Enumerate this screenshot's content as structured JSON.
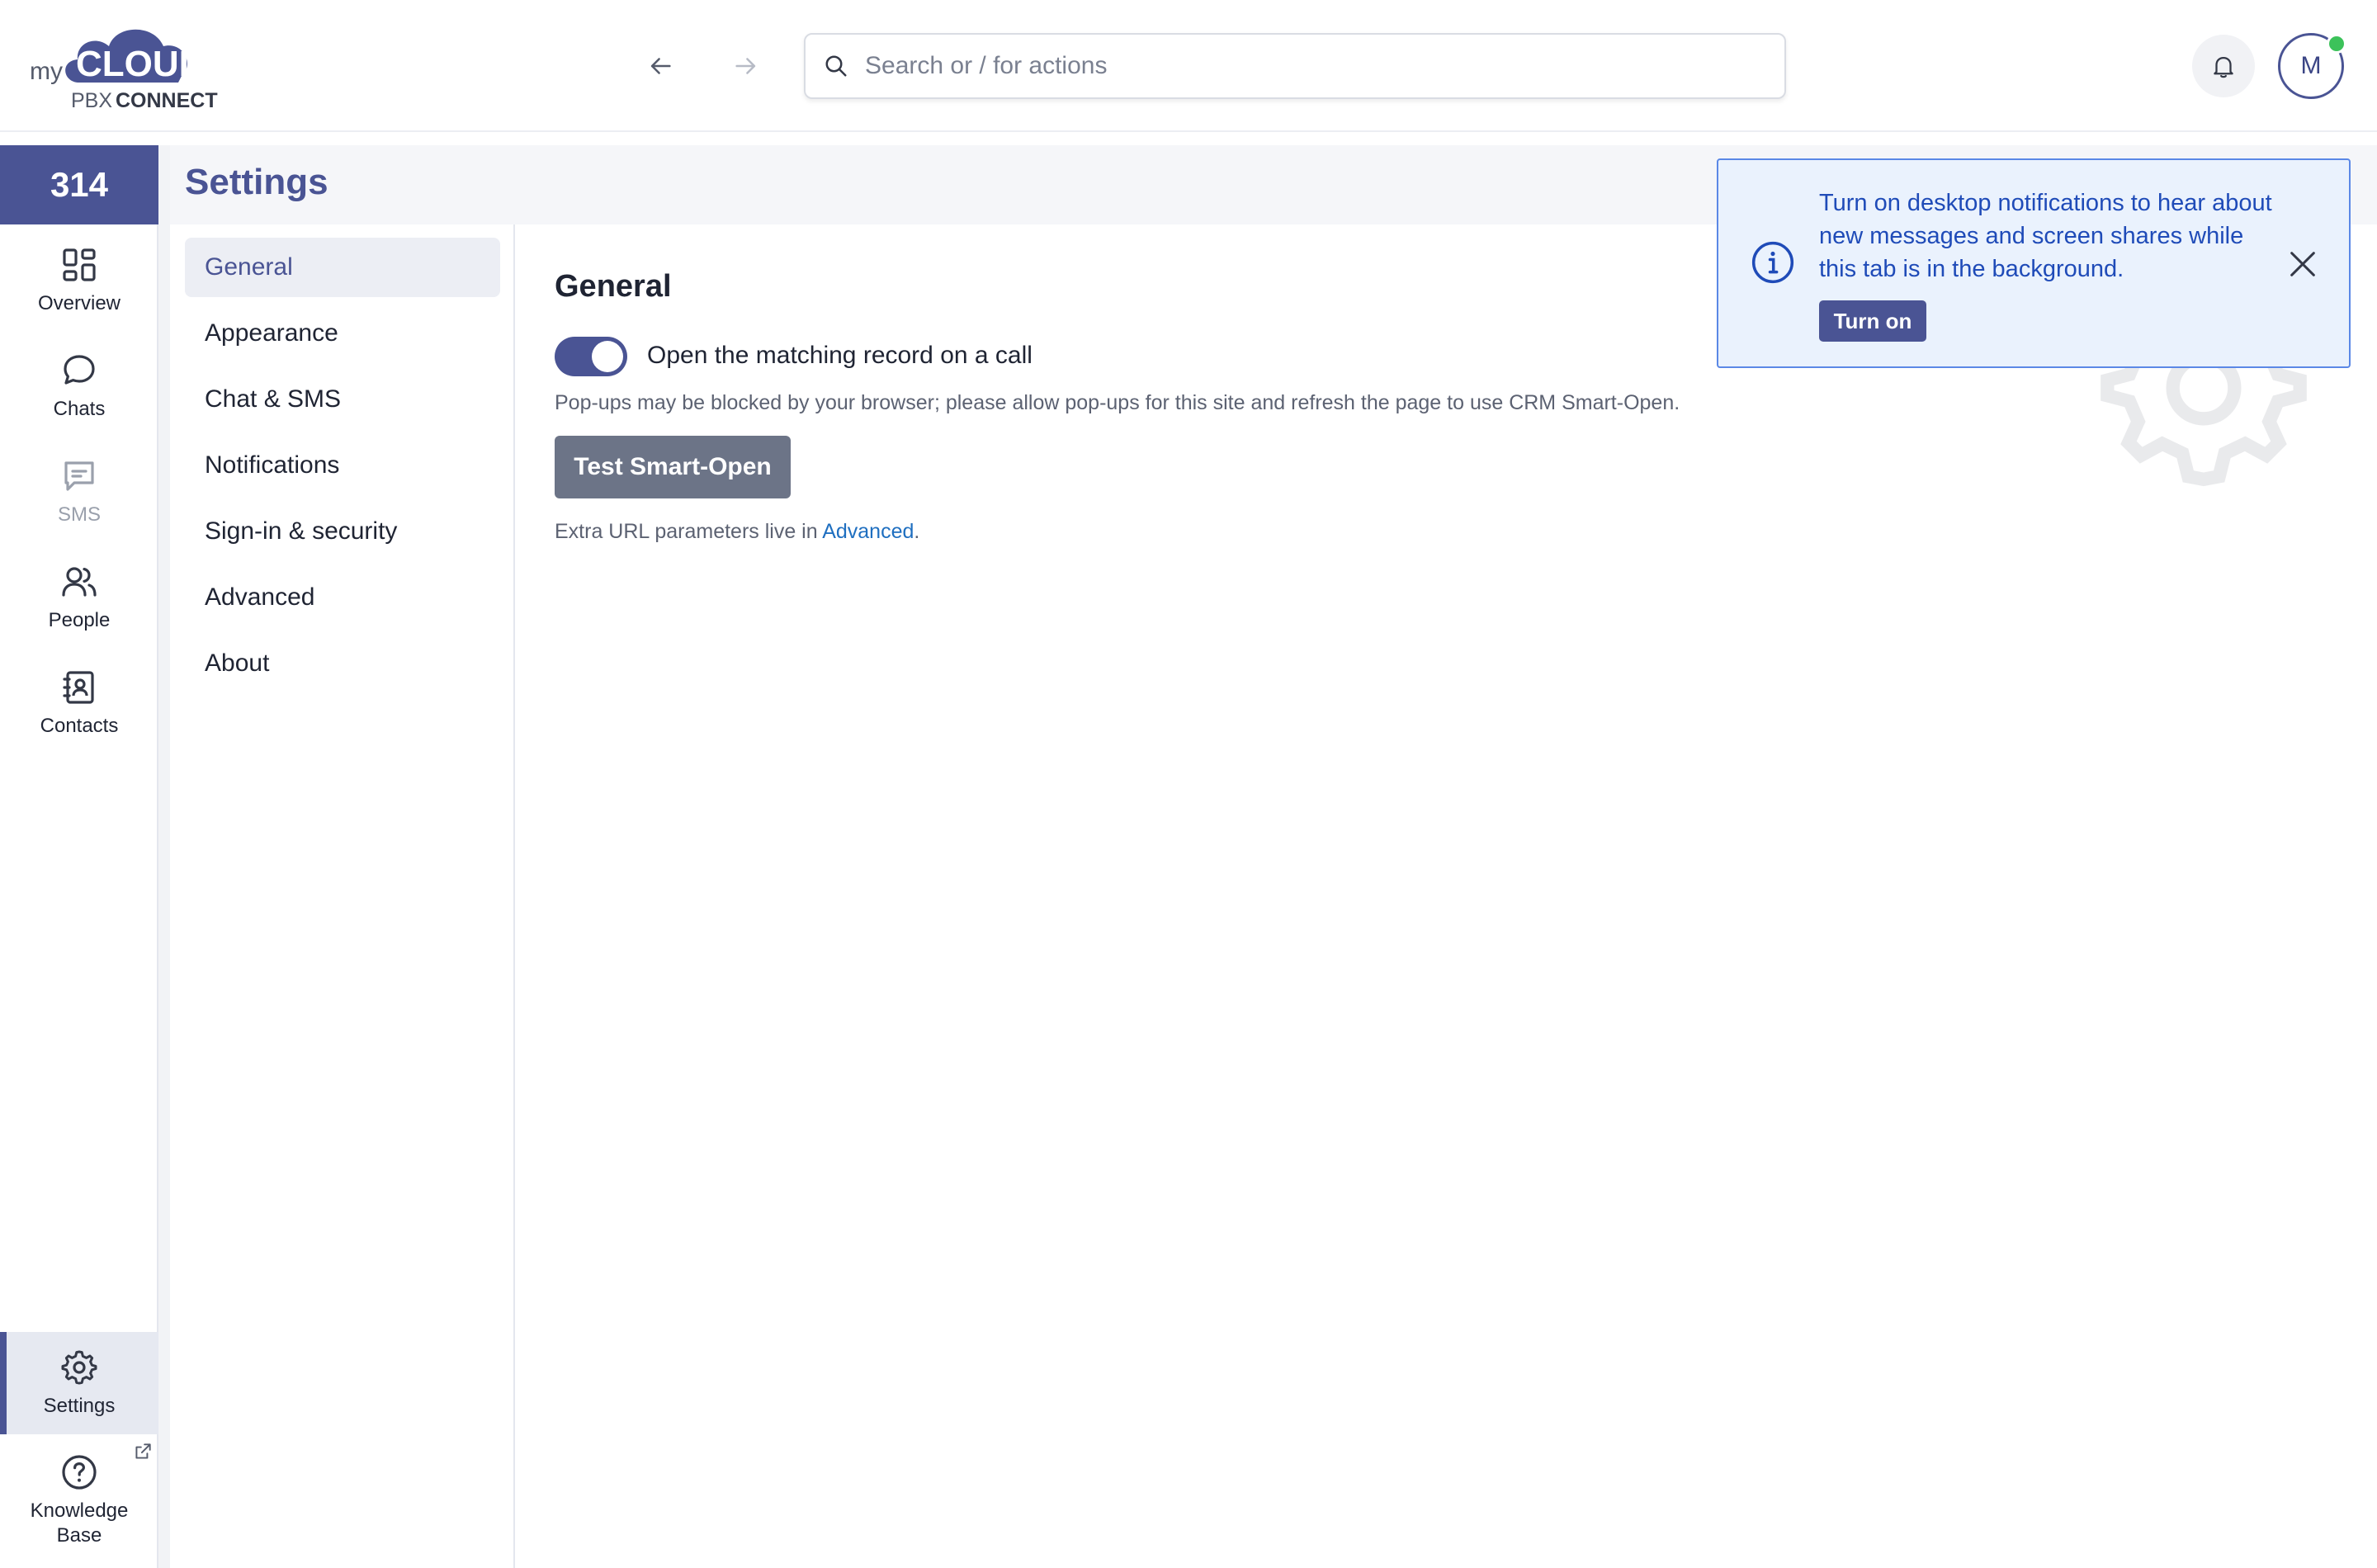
{
  "header": {
    "logo": {
      "my": "my",
      "cloud": "CLOUD",
      "pbx": "PBX",
      "connect": "CONNECT"
    },
    "search": {
      "placeholder": "Search or / for actions"
    },
    "avatar_initial": "M"
  },
  "rail": {
    "extension": "314",
    "items": [
      {
        "label": "Overview",
        "icon": "overview-icon"
      },
      {
        "label": "Chats",
        "icon": "chat-icon"
      },
      {
        "label": "SMS",
        "icon": "sms-icon"
      },
      {
        "label": "People",
        "icon": "people-icon"
      },
      {
        "label": "Contacts",
        "icon": "contacts-icon"
      }
    ],
    "settings_label": "Settings",
    "knowledge_label_1": "Knowledge",
    "knowledge_label_2": "Base"
  },
  "page": {
    "title": "Settings"
  },
  "subnav": {
    "items": [
      "General",
      "Appearance",
      "Chat & SMS",
      "Notifications",
      "Sign-in & security",
      "Advanced",
      "About"
    ],
    "active": "General"
  },
  "content": {
    "section_title": "General",
    "toggle_label": "Open the matching record on a call",
    "toggle_on": true,
    "hint": "Pop-ups may be blocked by your browser; please allow pop-ups for this site and refresh the page to use CRM Smart-Open.",
    "test_button": "Test Smart-Open",
    "extra_prefix": "Extra URL parameters live in ",
    "extra_link": "Advanced",
    "extra_suffix": "."
  },
  "toast": {
    "message": "Turn on desktop notifications to hear about new messages and screen shares while this tab is in the background.",
    "button": "Turn on"
  },
  "colors": {
    "brand": "#4a5494",
    "link": "#1f6fc0",
    "toast_text": "#1f4bb8",
    "presence": "#3cc25a"
  }
}
